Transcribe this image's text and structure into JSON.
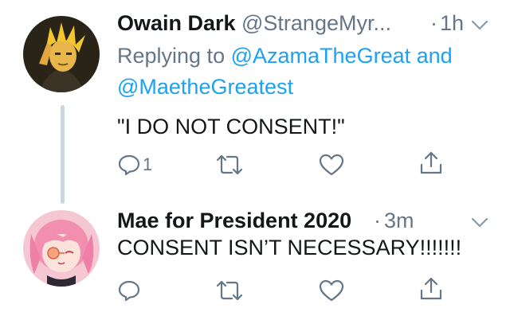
{
  "tweets": [
    {
      "display_name": "Owain Dark",
      "handle": "@StrangeMyr...",
      "separator": "·",
      "timestamp": "1h",
      "replying_prefix": "Replying to",
      "mention_1": "@AzamaTheGreat",
      "mention_joiner": "and",
      "mention_2": "@MaetheGreatest",
      "text": "\"I DO NOT CONSENT!\"",
      "reply_count": "1",
      "avatar_colors": {
        "bg": "#2a2418",
        "hair": "#f2c62c",
        "face": "#e8b64a"
      }
    },
    {
      "display_name": "Mae for President 2020",
      "separator": "·",
      "timestamp": "3m",
      "text": "CONSENT ISN’T NECESSARY!!!!!!!",
      "reply_count": "",
      "avatar_colors": {
        "bg": "#f4c7d2",
        "hair": "#f28fb0",
        "glasses": "#f5a47a"
      }
    }
  ],
  "icons": [
    "reply-icon",
    "retweet-icon",
    "like-icon",
    "share-icon",
    "chevron-down-icon"
  ],
  "colors": {
    "text": "#14171a",
    "muted": "#657786",
    "link": "#1da1f2",
    "thread_line": "#ccd6dd"
  }
}
